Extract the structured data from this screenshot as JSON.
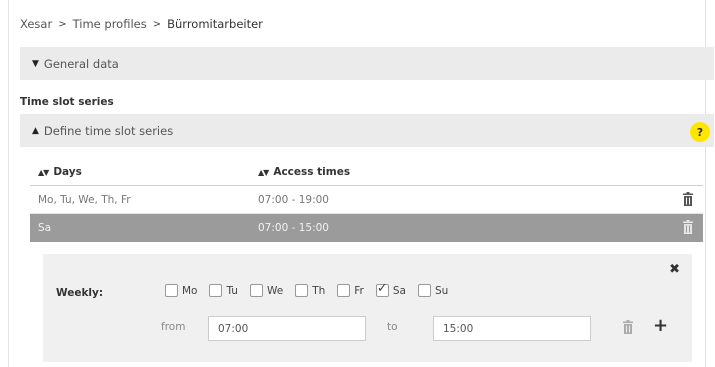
{
  "breadcrumb": {
    "items": [
      "Xesar",
      "Time profiles",
      "Bürromitarbeiter"
    ],
    "separator": ">"
  },
  "general_panel": {
    "label": "General data",
    "expanded": false
  },
  "section": {
    "title": "Time slot series"
  },
  "define_panel": {
    "label": "Define time slot series",
    "expanded": true,
    "help_label": "?"
  },
  "table": {
    "columns": [
      "Days",
      "Access times"
    ],
    "rows": [
      {
        "days": "Mo, Tu, We, Th, Fr",
        "times": "07:00 - 19:00",
        "selected": false
      },
      {
        "days": "Sa",
        "times": "07:00 - 15:00",
        "selected": true
      }
    ]
  },
  "editor": {
    "weekly_label": "Weekly:",
    "days": [
      {
        "label": "Mo",
        "checked": false
      },
      {
        "label": "Tu",
        "checked": false
      },
      {
        "label": "We",
        "checked": false
      },
      {
        "label": "Th",
        "checked": false
      },
      {
        "label": "Fr",
        "checked": false
      },
      {
        "label": "Sa",
        "checked": true
      },
      {
        "label": "Su",
        "checked": false
      }
    ],
    "from_label": "from",
    "from_value": "07:00",
    "to_label": "to",
    "to_value": "15:00"
  },
  "colors": {
    "panel_bg": "#ebebeb",
    "selected_row": "#9b9b9b",
    "help_yellow": "#ffe600",
    "editor_bg": "#f0f0f0"
  }
}
